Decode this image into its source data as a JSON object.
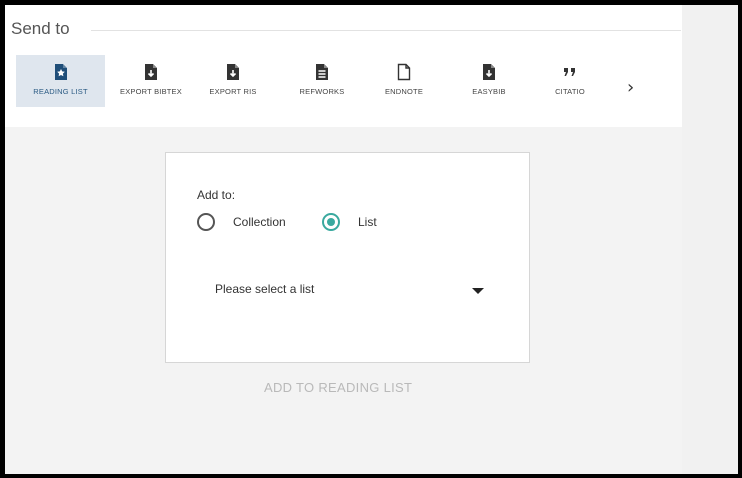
{
  "panel": {
    "title": "Send to"
  },
  "toolbar": {
    "items": [
      {
        "label": "READING LIST",
        "icon": "reading-list-icon",
        "active": true
      },
      {
        "label": "EXPORT BIBTEX",
        "icon": "export-bibtex-icon"
      },
      {
        "label": "EXPORT RIS",
        "icon": "export-ris-icon"
      },
      {
        "label": "REFWORKS",
        "icon": "refworks-icon"
      },
      {
        "label": "ENDNOTE",
        "icon": "endnote-icon"
      },
      {
        "label": "EASYBIB",
        "icon": "easybib-icon"
      },
      {
        "label": "CITATIO",
        "icon": "citation-quote-icon"
      }
    ],
    "next_icon": "chevron-right-icon"
  },
  "form": {
    "add_to_label": "Add to:",
    "options": [
      {
        "label": "Collection",
        "checked": false
      },
      {
        "label": "List",
        "checked": true
      }
    ],
    "select_value": "Please select a list"
  },
  "action": {
    "label": "ADD TO READING LIST"
  },
  "colors": {
    "accent": "#3aa99f",
    "active_tab_bg": "#dfe6ee",
    "active_icon": "#1f4e79"
  }
}
